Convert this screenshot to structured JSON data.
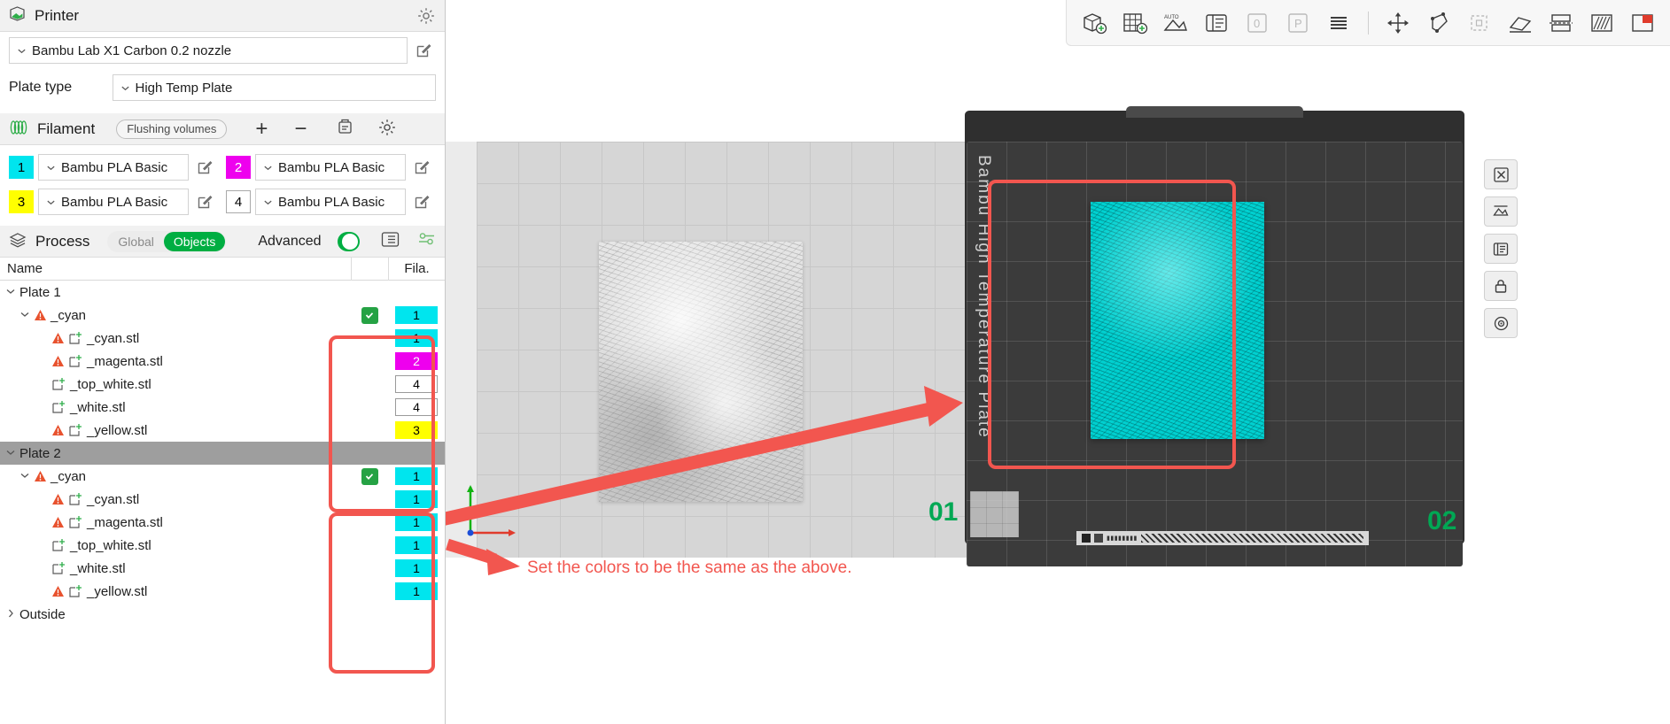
{
  "printer": {
    "section_title": "Printer",
    "gear_icon": "gear-icon",
    "printer_icon": "printer-icon",
    "model": "Bambu Lab X1 Carbon 0.2 nozzle",
    "plate_type_label": "Plate type",
    "plate_type_value": "High Temp Plate"
  },
  "filament": {
    "section_title": "Filament",
    "filament_icon": "filament-spool-icon",
    "flushing_volumes": "Flushing volumes",
    "add_label": "+",
    "remove_label": "−",
    "sync_icon": "sync-filament-icon",
    "settings_icon": "gear-icon",
    "slots": [
      {
        "index": "1",
        "name": "Bambu PLA Basic",
        "color": "#00e5ee",
        "text_color": "#000000",
        "bordered": false
      },
      {
        "index": "2",
        "name": "Bambu PLA Basic",
        "color": "#ee00ee",
        "text_color": "#ffffff",
        "bordered": false
      },
      {
        "index": "3",
        "name": "Bambu PLA Basic",
        "color": "#ffff00",
        "text_color": "#000000",
        "bordered": false
      },
      {
        "index": "4",
        "name": "Bambu PLA Basic",
        "color": "#ffffff",
        "text_color": "#000000",
        "bordered": true
      }
    ]
  },
  "process": {
    "section_title": "Process",
    "process_icon": "layers-icon",
    "segments": [
      {
        "label": "Global",
        "active": false
      },
      {
        "label": "Objects",
        "active": true
      }
    ],
    "advanced_label": "Advanced",
    "advanced_on": true,
    "list_view_icon": "list-view-icon",
    "filter_icon": "settings-filter-icon"
  },
  "tree": {
    "columns": {
      "name": "Name",
      "fila": "Fila."
    },
    "rows": [
      {
        "level": 0,
        "label": "Plate 1",
        "caret": "down",
        "warn": false,
        "modifier": false,
        "selected": false,
        "checkbox": false,
        "chip": null
      },
      {
        "level": 1,
        "label": "_cyan",
        "caret": "down",
        "warn": true,
        "modifier": false,
        "selected": false,
        "checkbox": true,
        "chip": {
          "num": "1",
          "color": "#00e5ee",
          "text": "#000000",
          "outline": false
        }
      },
      {
        "level": 2,
        "label": "_cyan.stl",
        "caret": "none",
        "warn": true,
        "modifier": true,
        "selected": false,
        "checkbox": false,
        "chip": {
          "num": "1",
          "color": "#00e5ee",
          "text": "#000000",
          "outline": false
        }
      },
      {
        "level": 2,
        "label": "_magenta.stl",
        "caret": "none",
        "warn": true,
        "modifier": true,
        "selected": false,
        "checkbox": false,
        "chip": {
          "num": "2",
          "color": "#ee00ee",
          "text": "#ffffff",
          "outline": false
        }
      },
      {
        "level": 2,
        "label": "_top_white.stl",
        "caret": "none",
        "warn": false,
        "modifier": true,
        "selected": false,
        "checkbox": false,
        "chip": {
          "num": "4",
          "color": "#ffffff",
          "text": "#000000",
          "outline": true
        }
      },
      {
        "level": 2,
        "label": "_white.stl",
        "caret": "none",
        "warn": false,
        "modifier": true,
        "selected": false,
        "checkbox": false,
        "chip": {
          "num": "4",
          "color": "#ffffff",
          "text": "#000000",
          "outline": true
        }
      },
      {
        "level": 2,
        "label": "_yellow.stl",
        "caret": "none",
        "warn": true,
        "modifier": true,
        "selected": false,
        "checkbox": false,
        "chip": {
          "num": "3",
          "color": "#ffff00",
          "text": "#000000",
          "outline": false
        }
      },
      {
        "level": 0,
        "label": "Plate 2",
        "caret": "down",
        "warn": false,
        "modifier": false,
        "selected": true,
        "checkbox": false,
        "chip": null
      },
      {
        "level": 1,
        "label": "_cyan",
        "caret": "down",
        "warn": true,
        "modifier": false,
        "selected": false,
        "checkbox": true,
        "chip": {
          "num": "1",
          "color": "#00e5ee",
          "text": "#000000",
          "outline": false
        }
      },
      {
        "level": 2,
        "label": "_cyan.stl",
        "caret": "none",
        "warn": true,
        "modifier": true,
        "selected": false,
        "checkbox": false,
        "chip": {
          "num": "1",
          "color": "#00e5ee",
          "text": "#000000",
          "outline": false
        }
      },
      {
        "level": 2,
        "label": "_magenta.stl",
        "caret": "none",
        "warn": true,
        "modifier": true,
        "selected": false,
        "checkbox": false,
        "chip": {
          "num": "1",
          "color": "#00e5ee",
          "text": "#000000",
          "outline": false
        }
      },
      {
        "level": 2,
        "label": "_top_white.stl",
        "caret": "none",
        "warn": false,
        "modifier": true,
        "selected": false,
        "checkbox": false,
        "chip": {
          "num": "1",
          "color": "#00e5ee",
          "text": "#000000",
          "outline": false
        }
      },
      {
        "level": 2,
        "label": "_white.stl",
        "caret": "none",
        "warn": false,
        "modifier": true,
        "selected": false,
        "checkbox": false,
        "chip": {
          "num": "1",
          "color": "#00e5ee",
          "text": "#000000",
          "outline": false
        }
      },
      {
        "level": 2,
        "label": "_yellow.stl",
        "caret": "none",
        "warn": true,
        "modifier": true,
        "selected": false,
        "checkbox": false,
        "chip": {
          "num": "1",
          "color": "#00e5ee",
          "text": "#000000",
          "outline": false
        }
      },
      {
        "level": 0,
        "label": "Outside",
        "caret": "right",
        "warn": false,
        "modifier": false,
        "selected": false,
        "checkbox": false,
        "chip": null
      }
    ]
  },
  "toolbar": {
    "items": [
      {
        "name": "add-object-icon",
        "enabled": true
      },
      {
        "name": "add-plate-icon",
        "enabled": true
      },
      {
        "name": "auto-arrange-icon",
        "enabled": true
      },
      {
        "name": "split-to-objects-icon",
        "enabled": true
      },
      {
        "name": "undo-icon",
        "enabled": false
      },
      {
        "name": "redo-icon",
        "enabled": false
      },
      {
        "name": "layers-icon",
        "enabled": true
      },
      {
        "name": "move-icon",
        "enabled": true
      },
      {
        "name": "scale-icon",
        "enabled": true
      },
      {
        "name": "rotate-icon",
        "enabled": false
      },
      {
        "name": "place-on-face-icon",
        "enabled": true
      },
      {
        "name": "cut-icon",
        "enabled": true
      },
      {
        "name": "support-paint-icon",
        "enabled": true
      },
      {
        "name": "color-paint-icon",
        "enabled": true
      },
      {
        "name": "text-icon",
        "enabled": true
      },
      {
        "name": "fill-bed-icon",
        "enabled": true
      },
      {
        "name": "assembly-view-icon",
        "enabled": true
      }
    ]
  },
  "viewport": {
    "plate1": {
      "number": "01",
      "side_buttons": [
        "delete-plate-icon",
        "arrange-plate-icon",
        "orient-plate-icon",
        "lock-plate-icon",
        "plate-settings-icon"
      ],
      "swatches": [
        "#cccc00",
        "#ee00ee",
        "#00e5ee"
      ]
    },
    "plate2": {
      "number": "02",
      "bed_label": "Bambu High Temperature Plate",
      "side_buttons": [
        "delete-plate-icon",
        "arrange-plate-icon",
        "orient-plate-icon",
        "lock-plate-icon",
        "plate-settings-icon"
      ],
      "model_color": "#00d5d5"
    },
    "annotation_text": "Set the colors to be the same as the above.",
    "annotation_color": "#f2564f"
  }
}
